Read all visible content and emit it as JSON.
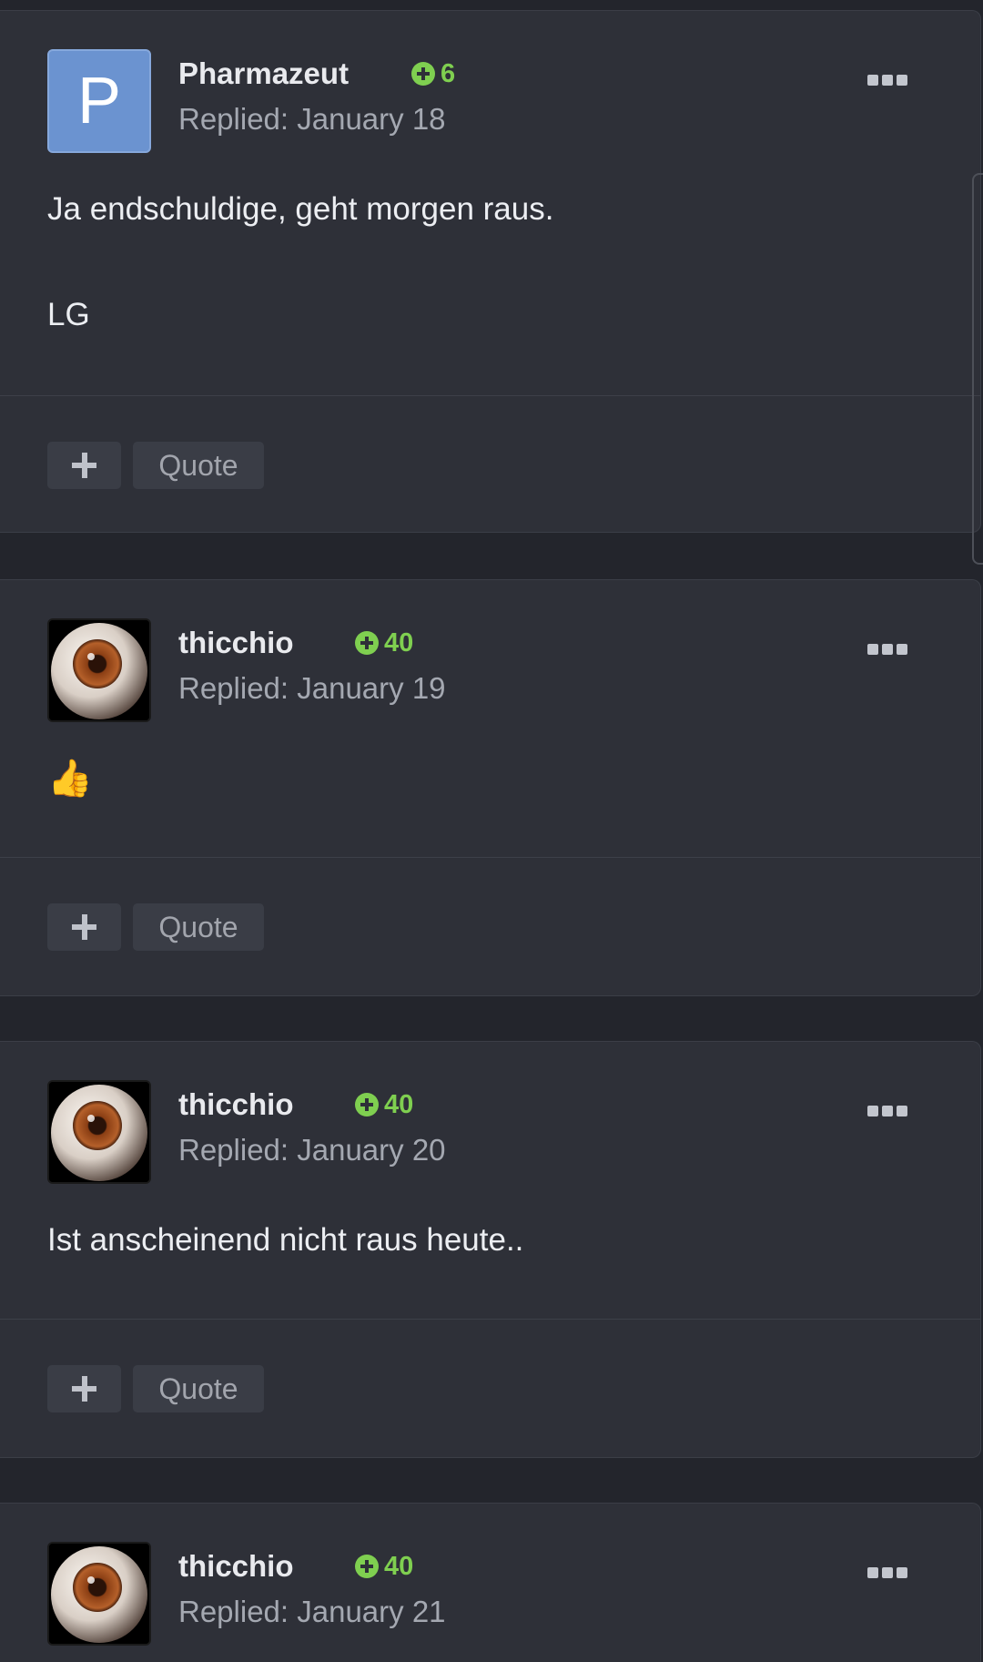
{
  "posts": [
    {
      "author": "Pharmazeut",
      "avatar_letter": "P",
      "avatar_type": "letter",
      "reputation": "6",
      "date": "Replied: January 18",
      "body": [
        "Ja endschuldige, geht morgen raus.",
        "LG"
      ],
      "actions": {
        "quote_label": "Quote"
      }
    },
    {
      "author": "thicchio",
      "avatar_type": "eyeball-image",
      "reputation": "40",
      "date": "Replied: January 19",
      "body_emoji": "👍",
      "actions": {
        "quote_label": "Quote"
      }
    },
    {
      "author": "thicchio",
      "avatar_type": "eyeball-image",
      "reputation": "40",
      "date": "Replied: January 20",
      "body": [
        "Ist anscheinend nicht raus heute.."
      ],
      "actions": {
        "quote_label": "Quote"
      }
    },
    {
      "author": "thicchio",
      "avatar_type": "eyeball-image",
      "reputation": "40",
      "date": "Replied: January 21"
    }
  ],
  "icons": {
    "reputation": "plus-circle-icon",
    "more": "ellipsis-icon",
    "react": "plus-icon"
  },
  "colors": {
    "background": "#23252c",
    "card": "#2e3038",
    "reputation": "#7fcf50",
    "avatar_letter_bg": "#6b93d0"
  }
}
